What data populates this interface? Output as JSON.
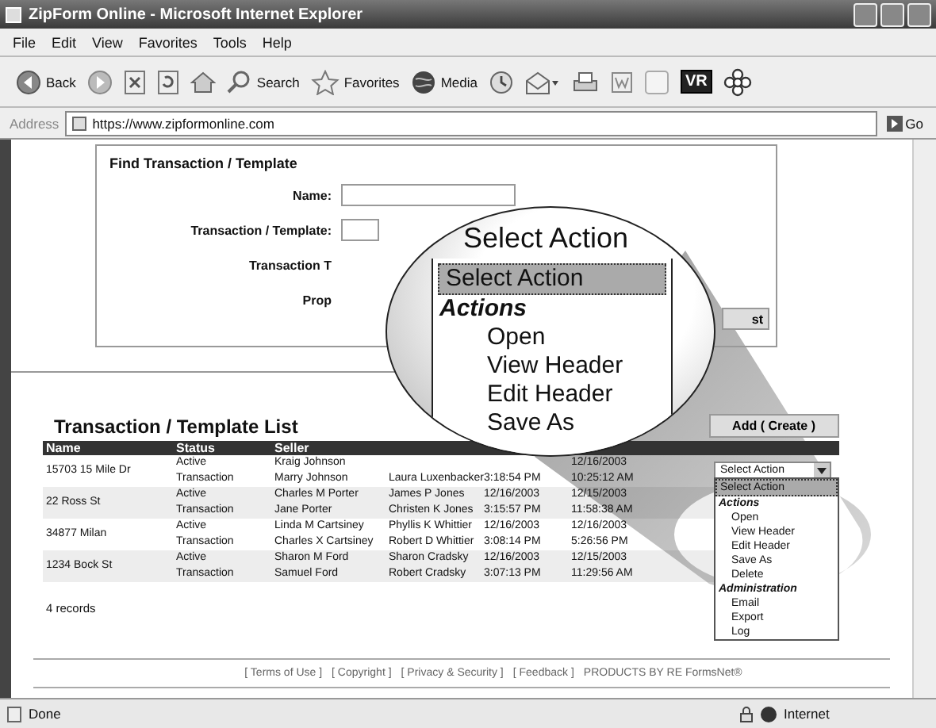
{
  "window": {
    "title": "ZipForm Online - Microsoft Internet Explorer"
  },
  "menu": [
    "File",
    "Edit",
    "View",
    "Favorites",
    "Tools",
    "Help"
  ],
  "toolbar": [
    {
      "kind": "back",
      "label": "Back"
    },
    {
      "kind": "forward"
    },
    {
      "kind": "stop"
    },
    {
      "kind": "refresh"
    },
    {
      "kind": "home"
    },
    {
      "kind": "search",
      "label": "Search"
    },
    {
      "kind": "favorites",
      "label": "Favorites"
    },
    {
      "kind": "media",
      "label": "Media"
    },
    {
      "kind": "history"
    },
    {
      "kind": "mail"
    },
    {
      "kind": "print"
    },
    {
      "kind": "edit"
    },
    {
      "kind": "blank"
    },
    {
      "kind": "vr",
      "label": "VR"
    },
    {
      "kind": "flower"
    }
  ],
  "address": {
    "label": "Address",
    "url": "https://www.zipformonline.com",
    "go": "Go"
  },
  "find": {
    "title": "Find Transaction / Template",
    "fields": [
      {
        "label": "Name:",
        "kind": "text"
      },
      {
        "label": "Transaction / Template:",
        "kind": "select"
      },
      {
        "label": "Transaction T",
        "kind": "none"
      },
      {
        "label": "Prop",
        "kind": "none"
      }
    ],
    "button": "st"
  },
  "list": {
    "title": "Transaction / Template List",
    "add_button": "Add ( Create )",
    "columns": [
      "Name",
      "Status",
      "Seller"
    ],
    "rows": [
      {
        "name": "15703 15 Mile Dr",
        "status": [
          "Active",
          "Transaction"
        ],
        "seller": [
          "Kraig Johnson",
          "Marry Johnson"
        ],
        "column_4": [
          "Laura Luxenbacker"
        ],
        "column_5": [
          "3:18:54 PM"
        ],
        "column_6": [
          "12/16/2003",
          "10:25:12 AM"
        ]
      },
      {
        "name": "22 Ross St",
        "status": [
          "Active",
          "Transaction"
        ],
        "seller": [
          "Charles M Porter",
          "Jane Porter"
        ],
        "column_4": [
          "James P Jones",
          "Christen K Jones"
        ],
        "column_5": [
          "12/16/2003",
          "3:15:57 PM"
        ],
        "column_6": [
          "12/15/2003",
          "11:58:38 AM"
        ]
      },
      {
        "name": "34877 Milan",
        "status": [
          "Active",
          "Transaction"
        ],
        "seller": [
          "Linda M Cartsiney",
          "Charles X Cartsiney"
        ],
        "column_4": [
          "Phyllis K Whittier",
          "Robert D Whittier"
        ],
        "column_5": [
          "12/16/2003",
          "3:08:14 PM"
        ],
        "column_6": [
          "12/16/2003",
          "5:26:56 PM"
        ]
      },
      {
        "name": "1234 Bock St",
        "status": [
          "Active",
          "Transaction"
        ],
        "seller": [
          "Sharon M Ford",
          "Samuel Ford"
        ],
        "column_4": [
          "Sharon Cradsky",
          "Robert Cradsky"
        ],
        "column_5": [
          "12/16/2003",
          "3:07:13 PM"
        ],
        "column_6": [
          "12/15/2003",
          "11:29:56 AM"
        ]
      }
    ],
    "count": "4 records",
    "action_menu": {
      "value": "Select Action",
      "options": [
        {
          "label": "Select Action",
          "kind": "option",
          "selected": true
        },
        {
          "label": "Actions",
          "kind": "group"
        },
        {
          "label": "Open",
          "kind": "option",
          "selected": false
        },
        {
          "label": "View Header",
          "kind": "option",
          "selected": false
        },
        {
          "label": "Edit Header",
          "kind": "option",
          "selected": false
        },
        {
          "label": "Save As",
          "kind": "option",
          "selected": false
        },
        {
          "label": "Delete",
          "kind": "option",
          "selected": false
        },
        {
          "label": "Administration",
          "kind": "group"
        },
        {
          "label": "Email",
          "kind": "option",
          "selected": false
        },
        {
          "label": "Export",
          "kind": "option",
          "selected": false
        },
        {
          "label": "Log",
          "kind": "option",
          "selected": false
        }
      ]
    }
  },
  "magnifier": {
    "caption": "Select Action",
    "options": [
      {
        "label": "Select Action",
        "kind": "option",
        "selected": true
      },
      {
        "label": "Actions",
        "kind": "group"
      },
      {
        "label": "Open",
        "kind": "option",
        "selected": false
      },
      {
        "label": "View Header",
        "kind": "option",
        "selected": false
      },
      {
        "label": "Edit Header",
        "kind": "option",
        "selected": false
      },
      {
        "label": "Save As",
        "kind": "option",
        "selected": false
      }
    ]
  },
  "footer": {
    "links": [
      "[ Terms of Use ]",
      "[ Copyright ]",
      "[ Privacy & Security ]",
      "[ Feedback ]"
    ],
    "credit": "PRODUCTS BY RE FormsNet®"
  },
  "status_bar": {
    "text": "Done",
    "zone": "Internet"
  }
}
